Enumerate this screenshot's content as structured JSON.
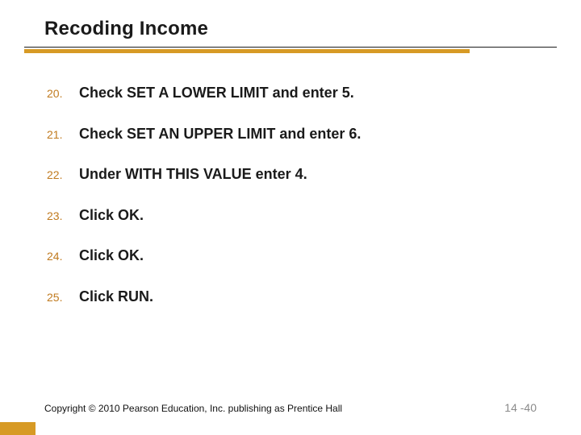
{
  "title": "Recoding Income",
  "items": [
    {
      "num": "20.",
      "text": "Check SET A LOWER LIMIT and enter 5."
    },
    {
      "num": "21.",
      "text": "Check SET AN UPPER LIMIT and enter 6."
    },
    {
      "num": "22.",
      "text": "Under WITH THIS VALUE enter 4."
    },
    {
      "num": "23.",
      "text": "Click OK."
    },
    {
      "num": "24.",
      "text": "Click OK."
    },
    {
      "num": "25.",
      "text": "Click RUN."
    }
  ],
  "copyright": "Copyright © 2010 Pearson Education, Inc. publishing as Prentice Hall",
  "page_number": "14 -40"
}
